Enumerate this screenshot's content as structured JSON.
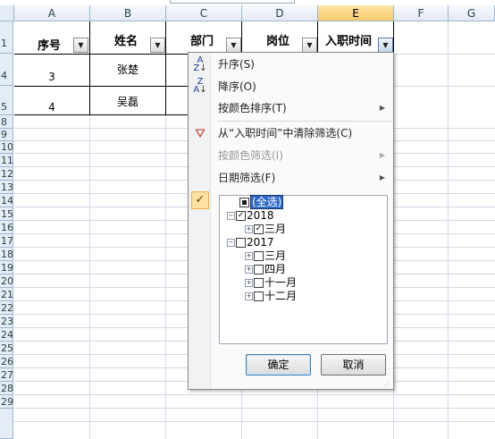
{
  "columns": [
    "A",
    "B",
    "C",
    "D",
    "E",
    "F",
    "G"
  ],
  "rows": [
    "1",
    "4",
    "5",
    "8",
    "9",
    "10",
    "11",
    "12",
    "13",
    "14",
    "15",
    "16",
    "17",
    "18",
    "19",
    "20",
    "21",
    "22",
    "23",
    "24",
    "25",
    "26",
    "27",
    "28",
    "29"
  ],
  "headers": {
    "a": "序号",
    "b": "姓名",
    "c": "部门",
    "d": "岗位",
    "e": "入职时间"
  },
  "data_rows": [
    {
      "a": "3",
      "b": "张楚"
    },
    {
      "a": "4",
      "b": "吴磊"
    }
  ],
  "menu": {
    "sort_asc": "升序(S)",
    "sort_desc": "降序(O)",
    "sort_by_color": "按颜色排序(T)",
    "clear_filter": "从“入职时间”中清除筛选(C)",
    "filter_by_color": "按颜色筛选(I)",
    "date_filter": "日期筛选(F)",
    "tree": {
      "select_all": "(全选)",
      "year_2018": "2018",
      "month_2018_mar": "三月",
      "year_2017": "2017",
      "months_2017": [
        "三月",
        "四月",
        "十一月",
        "十二月"
      ]
    },
    "ok": "确定",
    "cancel": "取消"
  },
  "colors": {
    "header_bg": "#e4ecf7",
    "active_header": "#f7c96b",
    "selection": "#316ac5",
    "menu_bg": "#fafafa"
  }
}
